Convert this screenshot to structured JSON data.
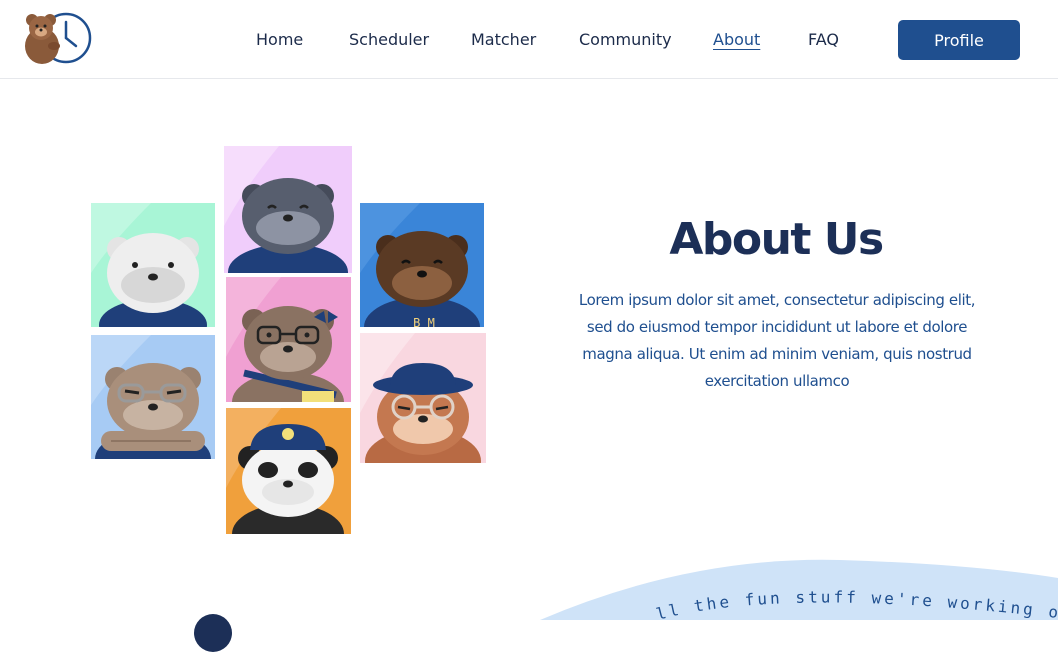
{
  "nav": {
    "items": [
      {
        "label": "Home"
      },
      {
        "label": "Scheduler"
      },
      {
        "label": "Matcher"
      },
      {
        "label": "Community"
      },
      {
        "label": "About"
      },
      {
        "label": "FAQ"
      }
    ],
    "active": "About",
    "profile_label": "Profile"
  },
  "about": {
    "title": "About Us",
    "body": "Lorem ipsum dolor sit amet, consectetur adipiscing elit, sed do eiusmod tempor incididunt ut labore et dolore magna aliqua. Ut enim ad minim veniam, quis nostrud exercitation ullamco"
  },
  "banner": {
    "curved_text": "ll the fun stuff we're working on!"
  },
  "bear_jacket_text": "B M",
  "colors": {
    "primary": "#1f4f8f",
    "dark_navy": "#1c2f57",
    "wave": "#cfe3f8",
    "tile_mint": "#a8f5d6",
    "tile_lilac": "#f0cdfb",
    "tile_blue": "#3a85d8",
    "tile_sky": "#a7cbf4",
    "tile_pink": "#f0a0d2",
    "tile_blush": "#f9d7e0",
    "tile_orange": "#f0a03c"
  },
  "icons": [
    "bear-clock-logo-icon"
  ]
}
